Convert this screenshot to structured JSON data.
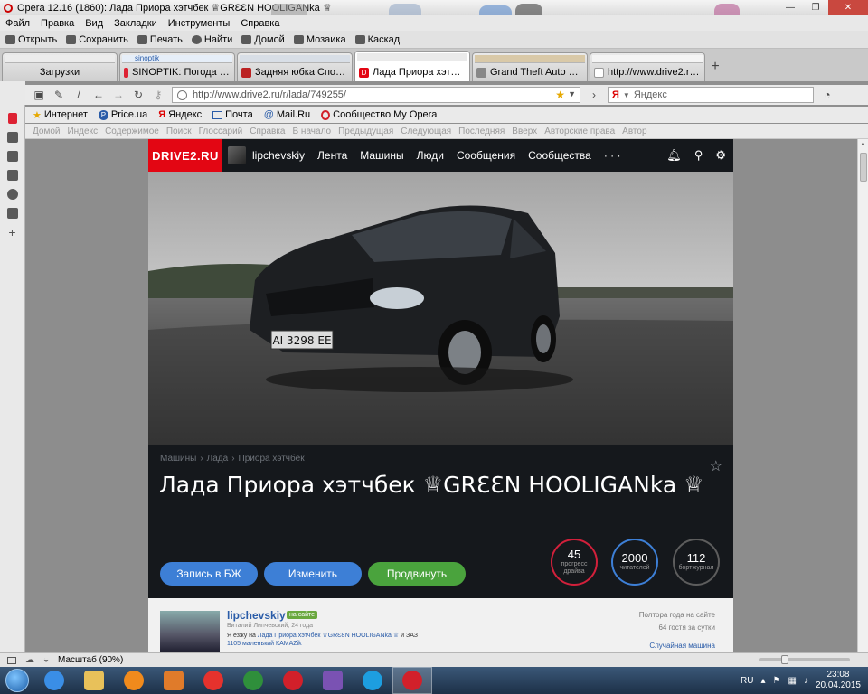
{
  "window": {
    "title": "Opera 12.16 (1860): Лада Приора хэтчбек ♕GRƐƐN HOOLIGANka ♕",
    "min_label": "—",
    "max_label": "❐",
    "close_label": "✕"
  },
  "menu": [
    "Файл",
    "Правка",
    "Вид",
    "Закладки",
    "Инструменты",
    "Справка"
  ],
  "toolbar": [
    "Открыть",
    "Сохранить",
    "Печать",
    "Найти",
    "Домой",
    "Мозаика",
    "Каскад"
  ],
  "tabs": [
    {
      "label": "Загрузки",
      "favicon_color": "#e6a800"
    },
    {
      "label": "SINOPTIK: Погода в О...",
      "thumb_text": "sinoptik",
      "favicon_color": "#d23"
    },
    {
      "label": "Задняя юбка Спорт Л...",
      "favicon_color": "#b22"
    },
    {
      "label": "Лада Приора хэтчбек ...",
      "favicon_color": "#e30613",
      "active": true
    },
    {
      "label": "Grand Theft Auto V (R...",
      "favicon_color": "#888"
    },
    {
      "label": "http://www.drive2.ru/l...",
      "favicon_color": "#bbb"
    }
  ],
  "tab_add_label": "+",
  "address": {
    "url": "http://www.drive2.ru/r/lada/749255/",
    "search_placeholder": "Яндекс",
    "search_engine": "Я"
  },
  "bookmarks": [
    "Интернет",
    "Price.ua",
    "Яндекс",
    "Почта",
    "Mail.Ru",
    "Сообщество My Opera"
  ],
  "site_nav": [
    "Домой",
    "Индекс",
    "Содержимое",
    "Поиск",
    "Глоссарий",
    "Справка",
    "В начало",
    "Предыдущая",
    "Следующая",
    "Последняя",
    "Вверх",
    "Авторские права",
    "Автор"
  ],
  "drive2": {
    "logo": "DRIVE2.RU",
    "username": "lipchevskiy",
    "menu": [
      "Лента",
      "Машины",
      "Люди",
      "Сообщения",
      "Сообщества",
      "· · ·"
    ],
    "icons": [
      "bell-icon",
      "search-icon",
      "gear-icon"
    ],
    "plate": "AI 3298 EE",
    "breadcrumbs": [
      "Машины",
      "›",
      "Лада",
      "›",
      "Приора хэтчбек"
    ],
    "title": "Лада Приора хэтчбек ♕GRƐƐN HOOLIGANka ♕",
    "buttons": {
      "bj": "Запись в БЖ",
      "edit": "Изменить",
      "promote": "Продвинуть"
    },
    "stats": [
      {
        "num": "45",
        "cap": "прогресс драйва"
      },
      {
        "num": "2000",
        "cap": "читателей"
      },
      {
        "num": "112",
        "cap": "бортжурнал"
      }
    ],
    "owner": {
      "name": "lipchevskiy",
      "online": "на сайте",
      "meta": "Виталий Липчевский, 24 года",
      "drive_prefix": "Я езжу на",
      "drive_link": "Лада Приора хэтчбек ♕GRƐƐN HOOLIGANka ♕",
      "drive_suffix": "и ЗАЗ",
      "kamaz": "1105 маленький КАМАZik",
      "since": "Полтора года на сайте",
      "guests": "64 гостя за сутки",
      "random": "Случайная машина"
    }
  },
  "status": {
    "zoom": "Масштаб (90%)"
  },
  "taskbar": {
    "lang": "RU",
    "time": "23:08",
    "date": "20.04.2015",
    "apps": [
      {
        "name": "ie",
        "color": "#3a8ee6"
      },
      {
        "name": "explorer",
        "color": "#e8c15a"
      },
      {
        "name": "avast",
        "color": "#f08a1c"
      },
      {
        "name": "media-player",
        "color": "#e07b2a"
      },
      {
        "name": "yandex-browser",
        "color": "#e5322d"
      },
      {
        "name": "android-tool",
        "color": "#2f8f3b"
      },
      {
        "name": "opera",
        "color": "#d2202a"
      },
      {
        "name": "visual-studio",
        "color": "#7a52b3"
      },
      {
        "name": "skype",
        "color": "#1d9ee0"
      },
      {
        "name": "opera-active",
        "color": "#d2202a"
      }
    ]
  }
}
